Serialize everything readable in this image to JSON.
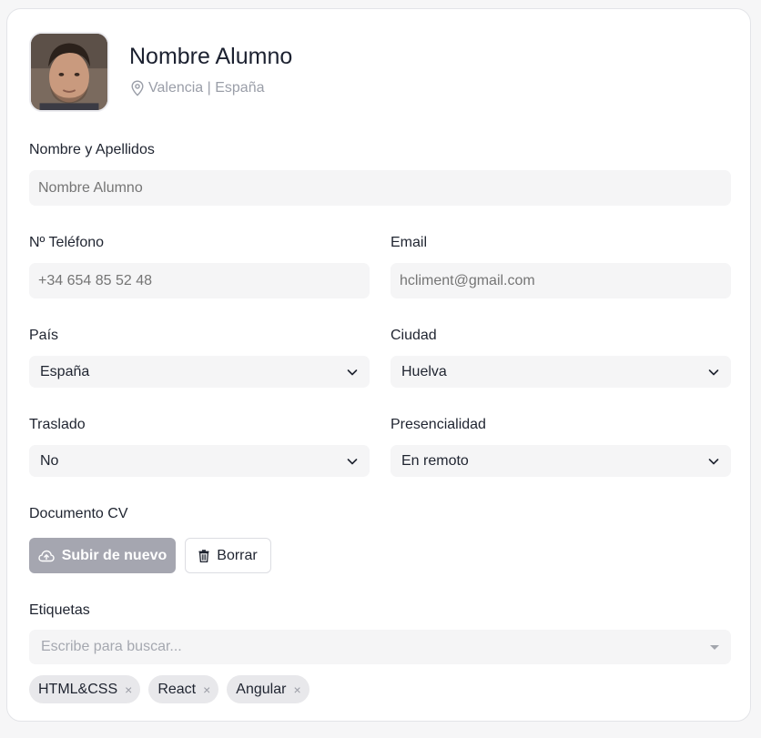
{
  "profile": {
    "name": "Nombre Alumno",
    "location": "Valencia | España"
  },
  "form": {
    "full_name": {
      "label": "Nombre y Apellidos",
      "placeholder": "Nombre Alumno"
    },
    "phone": {
      "label": "Nº Teléfono",
      "placeholder": "+34 654 85 52 48"
    },
    "email": {
      "label": "Email",
      "placeholder": "hcliment@gmail.com"
    },
    "country": {
      "label": "País",
      "value": "España"
    },
    "city": {
      "label": "Ciudad",
      "value": "Huelva"
    },
    "relocation": {
      "label": "Traslado",
      "value": "No"
    },
    "attendance": {
      "label": "Presencialidad",
      "value": "En remoto"
    }
  },
  "cv": {
    "label": "Documento CV",
    "upload_label": "Subir de nuevo",
    "delete_label": "Borrar"
  },
  "tags": {
    "label": "Etiquetas",
    "placeholder": "Escribe para buscar...",
    "items": [
      "HTML&CSS",
      "React",
      "Angular"
    ],
    "remove_glyph": "×"
  },
  "colors": {
    "upload_button_bg": "#a5a6b0",
    "field_bg": "#f5f5f6",
    "chip_bg": "#e8e8eb"
  },
  "icons": {
    "location": "map-pin-icon",
    "upload": "cloud-upload-icon",
    "delete": "trash-icon",
    "select": "chevron-down-icon"
  }
}
